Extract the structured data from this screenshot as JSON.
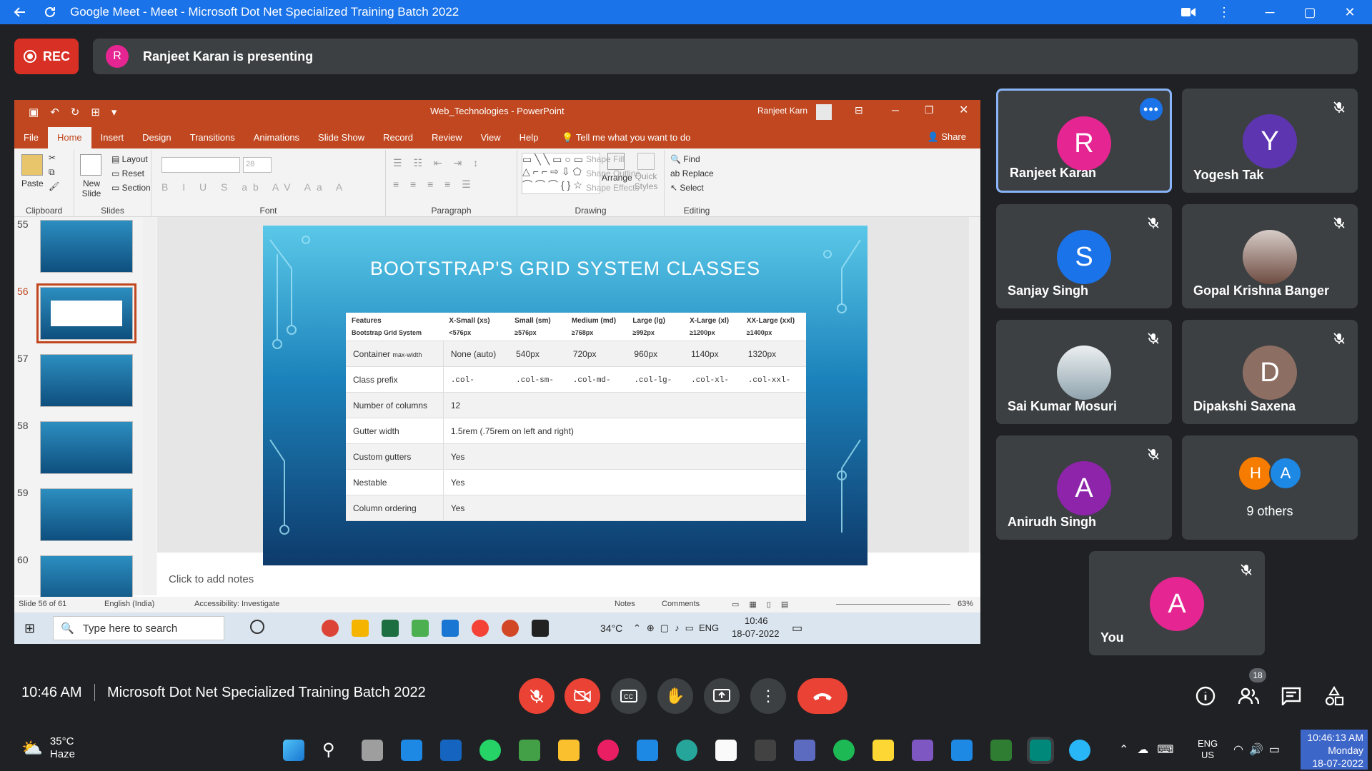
{
  "window": {
    "title": "Google Meet - Meet - Microsoft Dot Net Specialized Training Batch 2022"
  },
  "rec": {
    "label": "REC"
  },
  "presenter": {
    "initial": "R",
    "text": "Ranjeet Karan is presenting"
  },
  "powerpoint": {
    "doc_title": "Web_Technologies  -  PowerPoint",
    "user": "Ranjeet Karn",
    "tabs": [
      "File",
      "Home",
      "Insert",
      "Design",
      "Transitions",
      "Animations",
      "Slide Show",
      "Record",
      "Review",
      "View",
      "Help"
    ],
    "tell_me": "Tell me what you want to do",
    "share": "Share",
    "ribbon": {
      "clipboard": {
        "label": "Clipboard",
        "paste": "Paste"
      },
      "slides": {
        "label": "Slides",
        "new_slide": "New Slide",
        "layout": "Layout",
        "reset": "Reset",
        "section": "Section"
      },
      "font": {
        "label": "Font",
        "size": "28"
      },
      "paragraph": {
        "label": "Paragraph"
      },
      "drawing": {
        "label": "Drawing",
        "arrange": "Arrange",
        "quick_styles": "Quick Styles",
        "shape_fill": "Shape Fill",
        "shape_outline": "Shape Outline",
        "shape_effects": "Shape Effects"
      },
      "editing": {
        "label": "Editing",
        "find": "Find",
        "replace": "Replace",
        "select": "Select"
      }
    },
    "thumbnails": [
      {
        "num": "55"
      },
      {
        "num": "56",
        "selected": true
      },
      {
        "num": "57"
      },
      {
        "num": "58"
      },
      {
        "num": "59"
      },
      {
        "num": "60"
      }
    ],
    "slide": {
      "title": "BOOTSTRAP'S GRID SYSTEM CLASSES",
      "header": [
        {
          "h": "Features",
          "sub": "Bootstrap  Grid System"
        },
        {
          "h": "X-Small (xs)",
          "sub": "<576px"
        },
        {
          "h": "Small (sm)",
          "sub": "≥576px"
        },
        {
          "h": "Medium (md)",
          "sub": "≥768px"
        },
        {
          "h": "Large (lg)",
          "sub": "≥992px"
        },
        {
          "h": "X-Large (xl)",
          "sub": "≥1200px"
        },
        {
          "h": "XX-Large (xxl)",
          "sub": "≥1400px"
        }
      ],
      "rows": {
        "container": {
          "label": "Container",
          "label_small": "max-width",
          "values": [
            "None (auto)",
            "540px",
            "720px",
            "960px",
            "1140px",
            "1320px"
          ]
        },
        "class_prefix": {
          "label": "Class prefix",
          "values": [
            ".col-",
            ".col-sm-",
            ".col-md-",
            ".col-lg-",
            ".col-xl-",
            ".col-xxl-"
          ]
        },
        "number_of_columns": {
          "label": "Number of columns",
          "value": "12"
        },
        "gutter_width": {
          "label": "Gutter width",
          "value": "1.5rem (.75rem on left and right)"
        },
        "custom_gutters": {
          "label": "Custom gutters",
          "value": "Yes"
        },
        "nestable": {
          "label": "Nestable",
          "value": "Yes"
        },
        "column_ordering": {
          "label": "Column ordering",
          "value": "Yes"
        }
      }
    },
    "notes_placeholder": "Click to add notes",
    "status": {
      "slide": "Slide 56 of 61",
      "language": "English (India)",
      "accessibility": "Accessibility: Investigate",
      "notes": "Notes",
      "comments": "Comments",
      "zoom": "63%"
    }
  },
  "remote_taskbar": {
    "search_placeholder": "Type here to search",
    "temp": "34°C",
    "lang": "ENG",
    "time": "10:46",
    "date": "18-07-2022"
  },
  "participants": [
    {
      "initial": "R",
      "name": "Ranjeet Karan",
      "color": "#e52592",
      "active": true
    },
    {
      "initial": "Y",
      "name": "Yogesh Tak",
      "color": "#5e35b1"
    },
    {
      "initial": "S",
      "name": "Sanjay Singh",
      "color": "#1a73e8"
    },
    {
      "initial": "",
      "name": "Gopal Krishna Banger",
      "color": "#8d6e63"
    },
    {
      "initial": "",
      "name": "Sai Kumar Mosuri",
      "color": "#b0bec5"
    },
    {
      "initial": "D",
      "name": "Dipakshi Saxena",
      "color": "#8d6e63"
    },
    {
      "initial": "A",
      "name": "Anirudh Singh",
      "color": "#8e24aa"
    },
    {
      "name": "9 others",
      "mini": [
        {
          "initial": "H",
          "color": "#f57c00"
        },
        {
          "initial": "A",
          "color": "#1e88e5"
        }
      ]
    },
    {
      "initial": "A",
      "name": "You",
      "color": "#e52592"
    }
  ],
  "bottom": {
    "time": "10:46 AM",
    "meeting": "Microsoft Dot Net Specialized Training Batch 2022",
    "people_count": "18"
  },
  "w11": {
    "temp": "35°C",
    "weather": "Haze",
    "lang1": "ENG",
    "lang2": "US",
    "clock_time": "10:46:13 AM",
    "day": "Monday",
    "date": "18-07-2022"
  }
}
